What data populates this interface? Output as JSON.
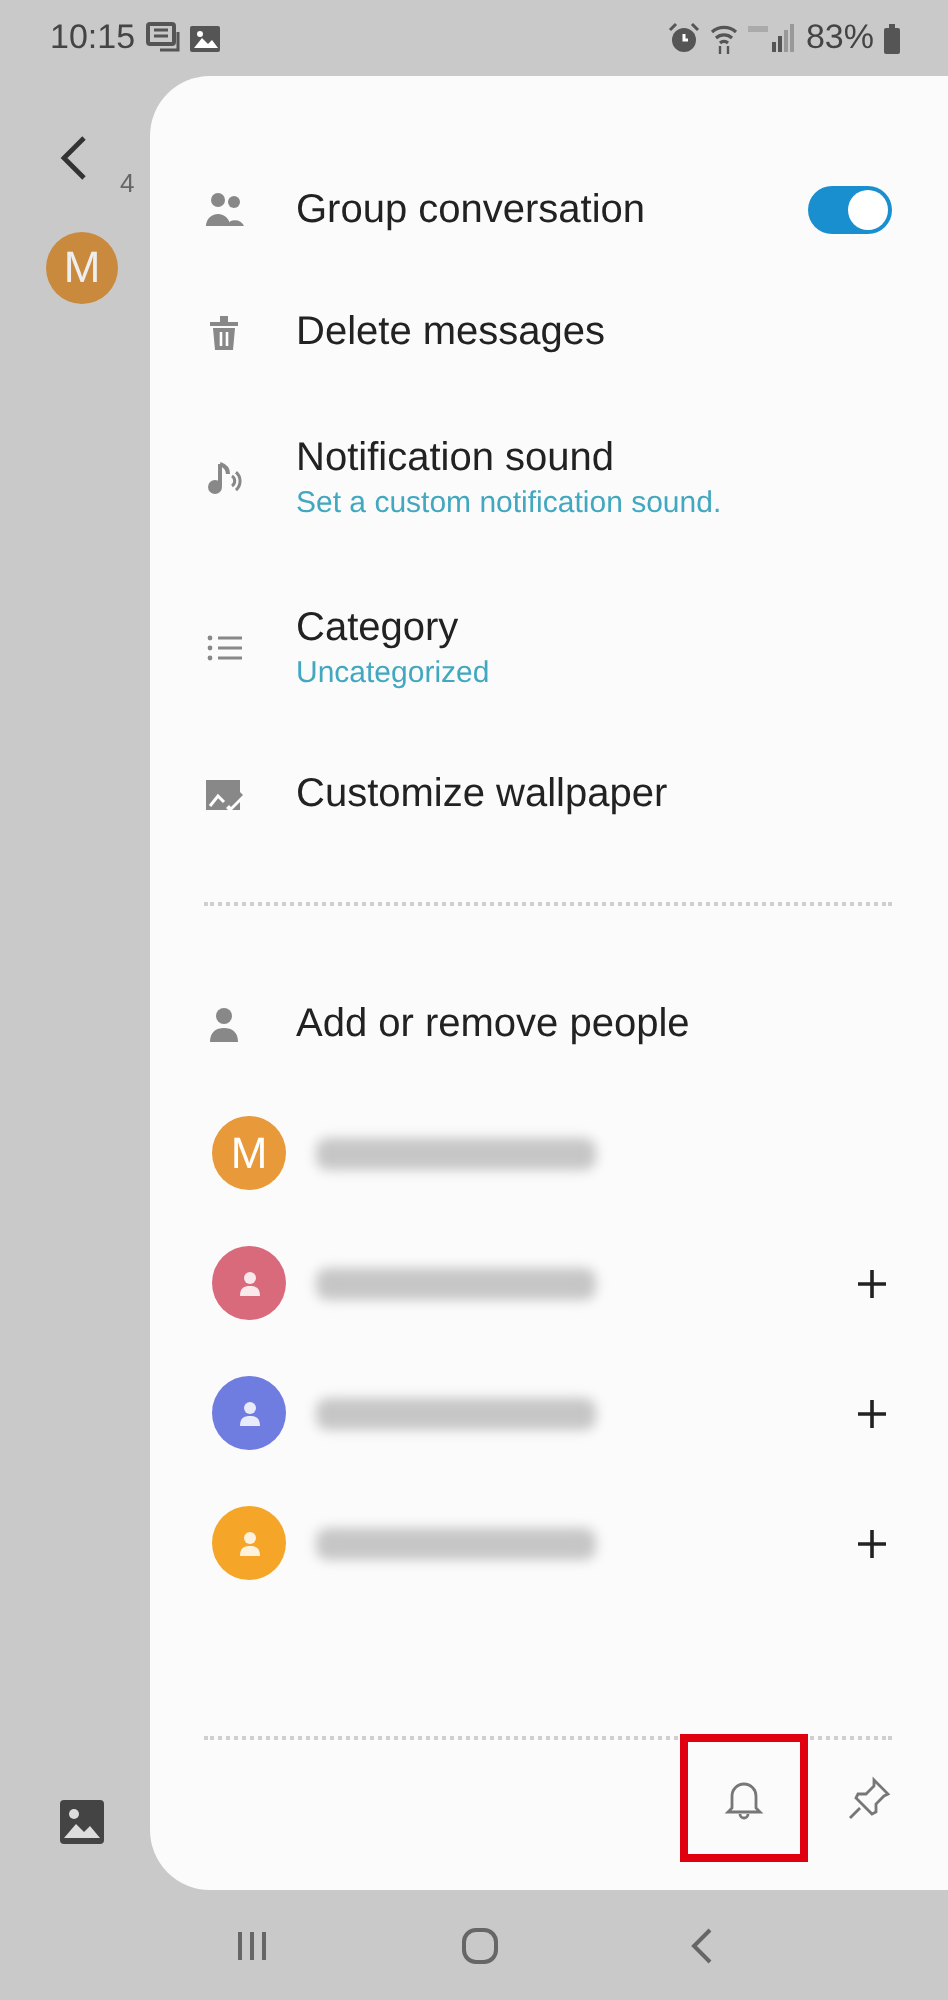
{
  "status_bar": {
    "time": "10:15",
    "battery": "83%"
  },
  "background": {
    "subtitle": "4",
    "avatar_letter": "M"
  },
  "menu": {
    "items": [
      {
        "kind": "toggle",
        "label": "Group conversation",
        "on": true
      },
      {
        "kind": "action",
        "label": "Delete messages"
      },
      {
        "kind": "setting",
        "label": "Notification sound",
        "value": "Set a custom notification sound."
      },
      {
        "kind": "setting",
        "label": "Category",
        "value": "Uncategorized"
      },
      {
        "kind": "action",
        "label": "Customize wallpaper"
      }
    ]
  },
  "people": {
    "label": "Add or remove people",
    "contacts": [
      {
        "avatar_letter": "M",
        "color": "#e8993a",
        "redacted": true,
        "addable": false
      },
      {
        "color": "#d96a7c",
        "redacted": true,
        "addable": true
      },
      {
        "color": "#6f7ce0",
        "redacted": true,
        "addable": true
      },
      {
        "color": "#f5a628",
        "redacted": true,
        "addable": true
      }
    ]
  },
  "footer": {
    "bell_highlighted": true
  }
}
